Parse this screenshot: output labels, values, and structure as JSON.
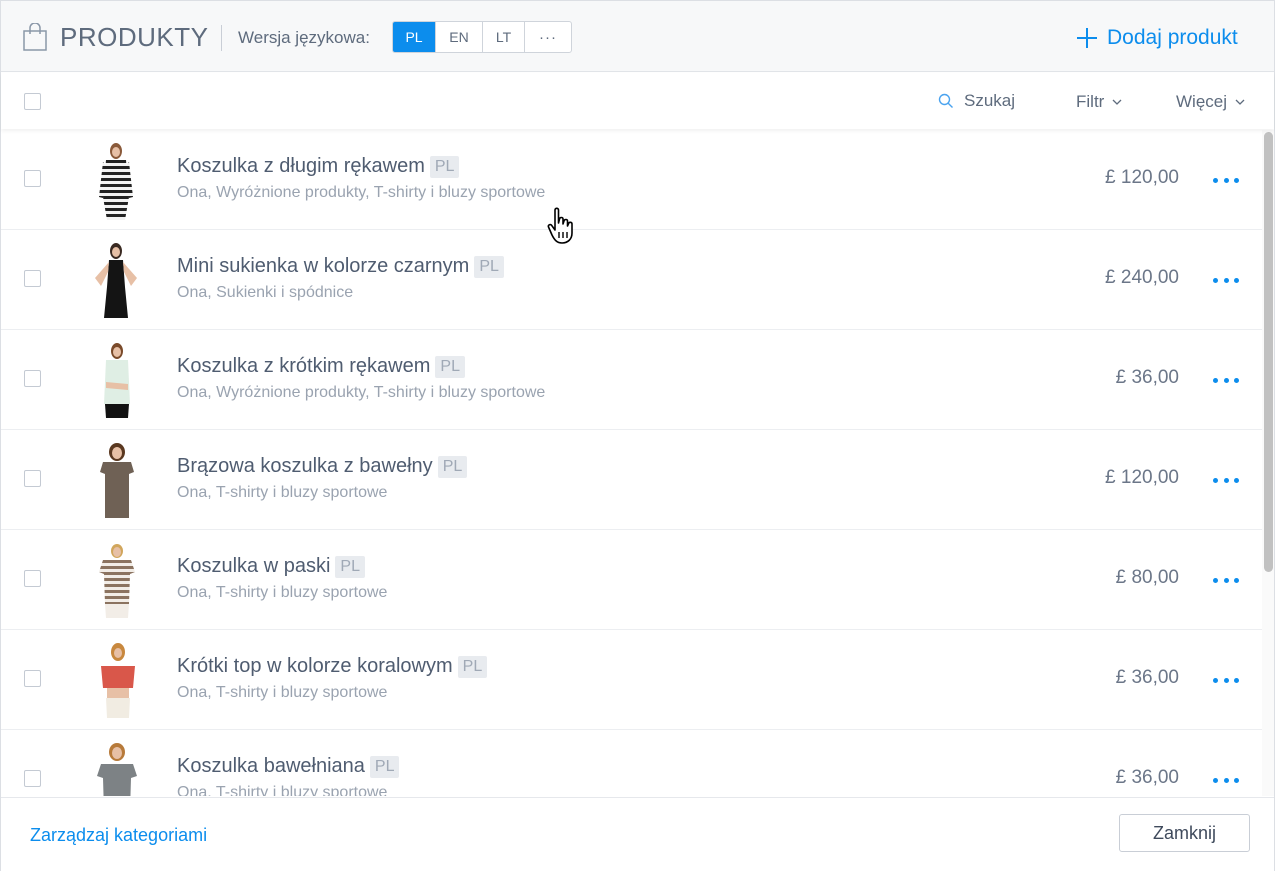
{
  "header": {
    "title": "PRODUKTY",
    "language_label": "Wersja językowa:",
    "languages": [
      "PL",
      "EN",
      "LT",
      "···"
    ],
    "active_language": "PL",
    "add_button": "Dodaj produkt"
  },
  "toolbar": {
    "search": "Szukaj",
    "filter": "Filtr",
    "more": "Więcej"
  },
  "products": [
    {
      "name": "Koszulka z długim rękawem",
      "lang": "PL",
      "categories": "Ona, Wyróżnione produkty, T-shirty i bluzy sportowe",
      "price": "£ 120,00",
      "thumb_color": "striped-black-white"
    },
    {
      "name": "Mini sukienka w kolorze czarnym",
      "lang": "PL",
      "categories": "Ona, Sukienki i spódnice",
      "price": "£ 240,00",
      "thumb_color": "black"
    },
    {
      "name": "Koszulka z krótkim rękawem",
      "lang": "PL",
      "categories": "Ona, Wyróżnione produkty, T-shirty i bluzy sportowe",
      "price": "£ 36,00",
      "thumb_color": "mint"
    },
    {
      "name": "Brązowa koszulka z bawełny",
      "lang": "PL",
      "categories": "Ona, T-shirty i bluzy sportowe",
      "price": "£ 120,00",
      "thumb_color": "brown"
    },
    {
      "name": "Koszulka w paski",
      "lang": "PL",
      "categories": "Ona, T-shirty i bluzy sportowe",
      "price": "£ 80,00",
      "thumb_color": "striped-brown-white"
    },
    {
      "name": "Krótki top w kolorze koralowym",
      "lang": "PL",
      "categories": "Ona, T-shirty i bluzy sportowe",
      "price": "£ 36,00",
      "thumb_color": "coral"
    },
    {
      "name": "Koszulka bawełniana",
      "lang": "PL",
      "categories": "Ona, T-shirty i bluzy sportowe",
      "price": "£ 36,00",
      "thumb_color": "grey"
    }
  ],
  "footer": {
    "manage_categories": "Zarządzaj kategoriami",
    "close": "Zamknij"
  },
  "colors": {
    "accent": "#0c8ded",
    "text": "#4f5c70",
    "muted": "#9aa3b0"
  }
}
